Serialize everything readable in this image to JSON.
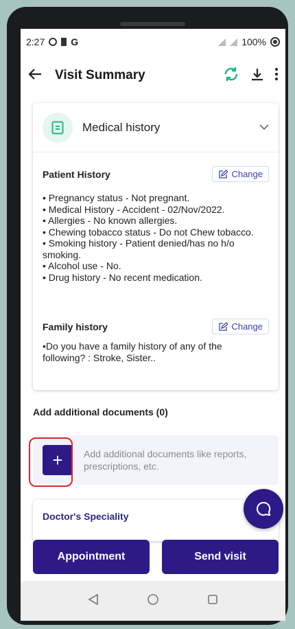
{
  "status_bar": {
    "time": "2:27",
    "carrier_letter": "G",
    "battery": "100%"
  },
  "app_bar": {
    "title": "Visit Summary"
  },
  "medical_card": {
    "header_label": "Medical history",
    "patient_history": {
      "title": "Patient History",
      "change_label": "Change",
      "bullets": [
        "• Pregnancy status - Not pregnant.",
        "• Medical History - Accident - 02/Nov/2022.",
        "• Allergies - No known allergies.",
        "• Chewing tobacco status - Do not Chew tobacco.",
        "• Smoking history - Patient denied/has no h/o",
        "smoking.",
        "• Alcohol use - No.",
        "• Drug history - No recent medication."
      ]
    },
    "family_history": {
      "title": "Family history",
      "change_label": "Change",
      "lines": [
        "•Do you have a family history of any of the",
        "following? : Stroke, Sister.."
      ]
    }
  },
  "documents": {
    "title": "Add additional documents (0)",
    "add_button_symbol": "+",
    "hint": "Add additional documents like reports, prescriptions, etc."
  },
  "speciality": {
    "title": "Doctor's Speciality"
  },
  "buttons": {
    "appointment": "Appointment",
    "send_visit": "Send visit"
  },
  "colors": {
    "primary": "#2e1a87",
    "accent_green": "#1fb87e",
    "highlight": "#d9262c"
  }
}
